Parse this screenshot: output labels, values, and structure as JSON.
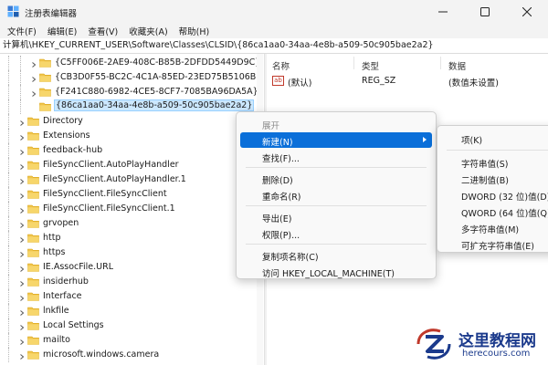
{
  "window": {
    "title": "注册表编辑器"
  },
  "menu": [
    "文件(F)",
    "编辑(E)",
    "查看(V)",
    "收藏夹(A)",
    "帮助(H)"
  ],
  "address": "计算机\\HKEY_CURRENT_USER\\Software\\Classes\\CLSID\\{86ca1aa0-34aa-4e8b-a509-50c905bae2a2}",
  "tree": {
    "items": [
      {
        "label": "{C5FF006E-2AE9-408C-B85B-2DFDD5449D9C}",
        "expandable": true
      },
      {
        "label": "{CB3D0F55-BC2C-4C1A-85ED-23ED75B5106B}",
        "expandable": true
      },
      {
        "label": "{F241C880-6982-4CE5-8CF7-7085BA96DA5A}",
        "expandable": true
      },
      {
        "label": "{86ca1aa0-34aa-4e8b-a509-50c905bae2a2}",
        "expandable": false,
        "selected": true
      },
      {
        "label": "Directory",
        "expandable": true
      },
      {
        "label": "Extensions",
        "expandable": true
      },
      {
        "label": "feedback-hub",
        "expandable": true
      },
      {
        "label": "FileSyncClient.AutoPlayHandler",
        "expandable": true
      },
      {
        "label": "FileSyncClient.AutoPlayHandler.1",
        "expandable": true
      },
      {
        "label": "FileSyncClient.FileSyncClient",
        "expandable": true
      },
      {
        "label": "FileSyncClient.FileSyncClient.1",
        "expandable": true
      },
      {
        "label": "grvopen",
        "expandable": true
      },
      {
        "label": "http",
        "expandable": true
      },
      {
        "label": "https",
        "expandable": true
      },
      {
        "label": "IE.AssocFile.URL",
        "expandable": true
      },
      {
        "label": "insiderhub",
        "expandable": true
      },
      {
        "label": "Interface",
        "expandable": true
      },
      {
        "label": "lnkfile",
        "expandable": true
      },
      {
        "label": "Local Settings",
        "expandable": true
      },
      {
        "label": "mailto",
        "expandable": true
      },
      {
        "label": "microsoft.windows.camera",
        "expandable": true
      }
    ]
  },
  "values": {
    "headers": {
      "name": "名称",
      "type": "类型",
      "data": "数据"
    },
    "rows": [
      {
        "icon": "ab",
        "name": "(默认)",
        "type": "REG_SZ",
        "data": "(数值未设置)"
      }
    ]
  },
  "context_menu": {
    "items": [
      {
        "label": "展开",
        "disabled": true
      },
      {
        "label": "新建(N)",
        "active": true,
        "submenu": true
      },
      {
        "label": "查找(F)..."
      },
      {
        "separator": true
      },
      {
        "label": "删除(D)"
      },
      {
        "label": "重命名(R)"
      },
      {
        "separator": true
      },
      {
        "label": "导出(E)"
      },
      {
        "label": "权限(P)..."
      },
      {
        "separator": true
      },
      {
        "label": "复制项名称(C)"
      },
      {
        "label": "访问 HKEY_LOCAL_MACHINE(T)"
      }
    ]
  },
  "submenu": {
    "items": [
      {
        "label": "项(K)"
      },
      {
        "separator": true
      },
      {
        "label": "字符串值(S)"
      },
      {
        "label": "二进制值(B)"
      },
      {
        "label": "DWORD (32 位)值(D)"
      },
      {
        "label": "QWORD (64 位)值(Q)"
      },
      {
        "label": "多字符串值(M)"
      },
      {
        "label": "可扩充字符串值(E)"
      }
    ]
  },
  "watermark": {
    "name": "这里教程网",
    "url": "herecours.com"
  },
  "colors": {
    "accent": "#0a6fd9",
    "selection": "#cce8ff",
    "folder": "#f0c44b",
    "watermark": "#1b3a8c"
  }
}
